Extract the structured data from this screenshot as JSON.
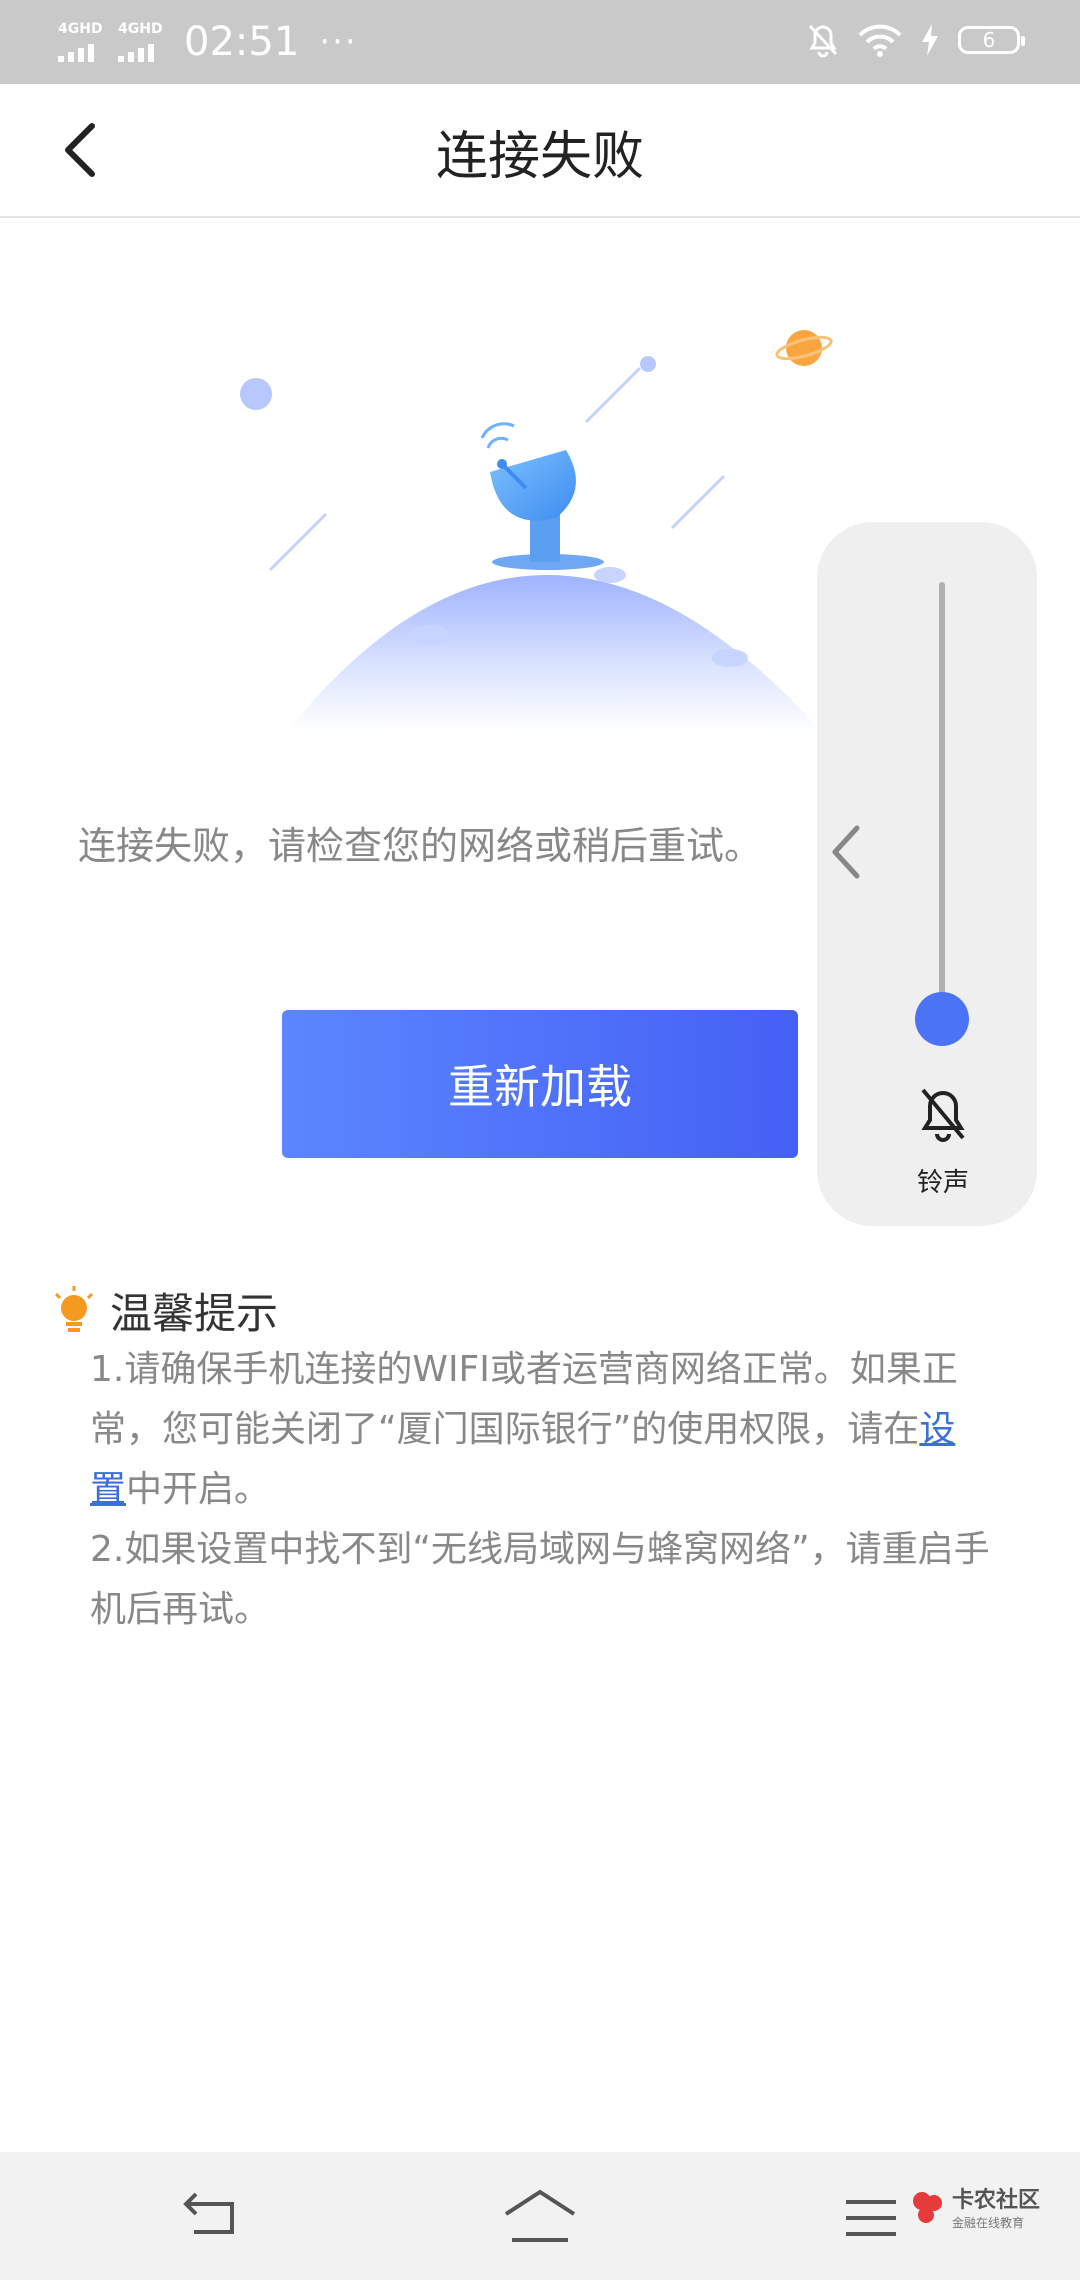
{
  "status_bar": {
    "sim1": "4GHD",
    "sim2": "4GHD",
    "time": "02:51",
    "more": "···",
    "battery": "6"
  },
  "header": {
    "title": "连接失败"
  },
  "message": "连接失败，请检查您的网络或稍后重试。",
  "reload_button": "重新加载",
  "tips": {
    "title": "温馨提示",
    "line1_pre": "1.请确保手机连接的WIFI或者运营商网络正常。如果正常，您可能关闭了“厦门国际银行”的使用权限，请在",
    "line1_link": "设置",
    "line1_post": "中开启。",
    "line2": "2.如果设置中找不到“无线局域网与蜂窝网络”，请重启手机后再试。"
  },
  "volume_panel": {
    "label": "铃声",
    "level": 0
  },
  "watermark": {
    "main": "卡农社区",
    "sub": "金融在线教育"
  },
  "colors": {
    "accent": "#4b6ef8",
    "link": "#3d6fd8",
    "tip_icon": "#f39a1f"
  }
}
